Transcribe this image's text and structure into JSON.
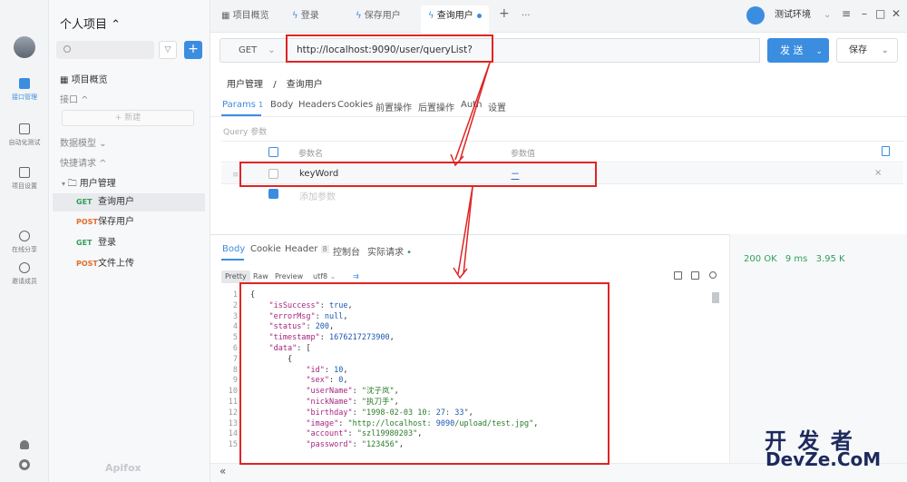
{
  "rail": {
    "items": [
      {
        "label": "接口管理"
      },
      {
        "label": "自动化测试"
      },
      {
        "label": "项目设置"
      },
      {
        "label": "在线分享"
      },
      {
        "label": "邀请成员"
      }
    ]
  },
  "sidebar": {
    "project_title": "个人项目 ⌃",
    "overview": "项目概览",
    "interfaces": "接口 ^",
    "new_label": "+ 新建",
    "data_models": "数据模型 ⌄",
    "quick_requests": "快捷请求 ^",
    "folder": "用户管理",
    "apis": [
      {
        "method": "GET",
        "name": "查询用户"
      },
      {
        "method": "POST",
        "name": "保存用户"
      },
      {
        "method": "GET",
        "name": "登录"
      },
      {
        "method": "POST",
        "name": "文件上传"
      }
    ],
    "brand": "Apifox"
  },
  "tabs": [
    {
      "label": "项目概览"
    },
    {
      "label": "登录"
    },
    {
      "label": "保存用户"
    },
    {
      "label": "查询用户"
    }
  ],
  "env": {
    "label": "测试环境"
  },
  "request": {
    "method": "GET",
    "url": "http://localhost:9090/user/queryList?",
    "send_label": "发 送",
    "save_label": "保存",
    "breadcrumb_parent": "用户管理",
    "breadcrumb_sep": "/",
    "breadcrumb_current": "查询用户",
    "tabs": [
      "Params",
      "Body",
      "Headers",
      "Cookies",
      "前置操作",
      "后置操作",
      "Auth",
      "设置"
    ],
    "params_count": "1",
    "query_label": "Query 参数",
    "col_name": "参数名",
    "col_value": "参数值",
    "params": [
      {
        "name": "keyWord",
        "value": "二"
      }
    ],
    "add_param_placeholder": "添加参数"
  },
  "response": {
    "tabs": [
      "Body",
      "Cookie",
      "Header",
      "控制台",
      "实际请求"
    ],
    "header_count": "8",
    "formats": [
      "Pretty",
      "Raw",
      "Preview"
    ],
    "encoding": "utf8",
    "status": "200 OK",
    "time": "9 ms",
    "size": "3.95 K",
    "lines": [
      {
        "num": "1",
        "text": "{"
      },
      {
        "num": "2",
        "text": "    \"isSuccess\": true,"
      },
      {
        "num": "3",
        "text": "    \"errorMsg\": null,"
      },
      {
        "num": "4",
        "text": "    \"status\": 200,"
      },
      {
        "num": "5",
        "text": "    \"timestamp\": 1676217273900,"
      },
      {
        "num": "6",
        "text": "    \"data\": ["
      },
      {
        "num": "7",
        "text": "        {"
      },
      {
        "num": "8",
        "text": "            \"id\": 10,"
      },
      {
        "num": "9",
        "text": "            \"sex\": 0,"
      },
      {
        "num": "10",
        "text": "            \"userName\": \"沈子岚\","
      },
      {
        "num": "11",
        "text": "            \"nickName\": \"执刀手\","
      },
      {
        "num": "12",
        "text": "            \"birthday\": \"1998-02-03 10:27:33\","
      },
      {
        "num": "13",
        "text": "            \"image\": \"http://localhost:9090/upload/test.jpg\","
      },
      {
        "num": "14",
        "text": "            \"account\": \"szl19980203\","
      },
      {
        "num": "15",
        "text": "            \"password\": \"123456\","
      }
    ]
  },
  "watermark": {
    "line1": "开 发 者",
    "line2": "DevZe.CoM"
  },
  "colors": {
    "accent": "#3b8de0",
    "get": "#2fa05a",
    "post": "#e06d2b",
    "annotation": "#e02424"
  }
}
